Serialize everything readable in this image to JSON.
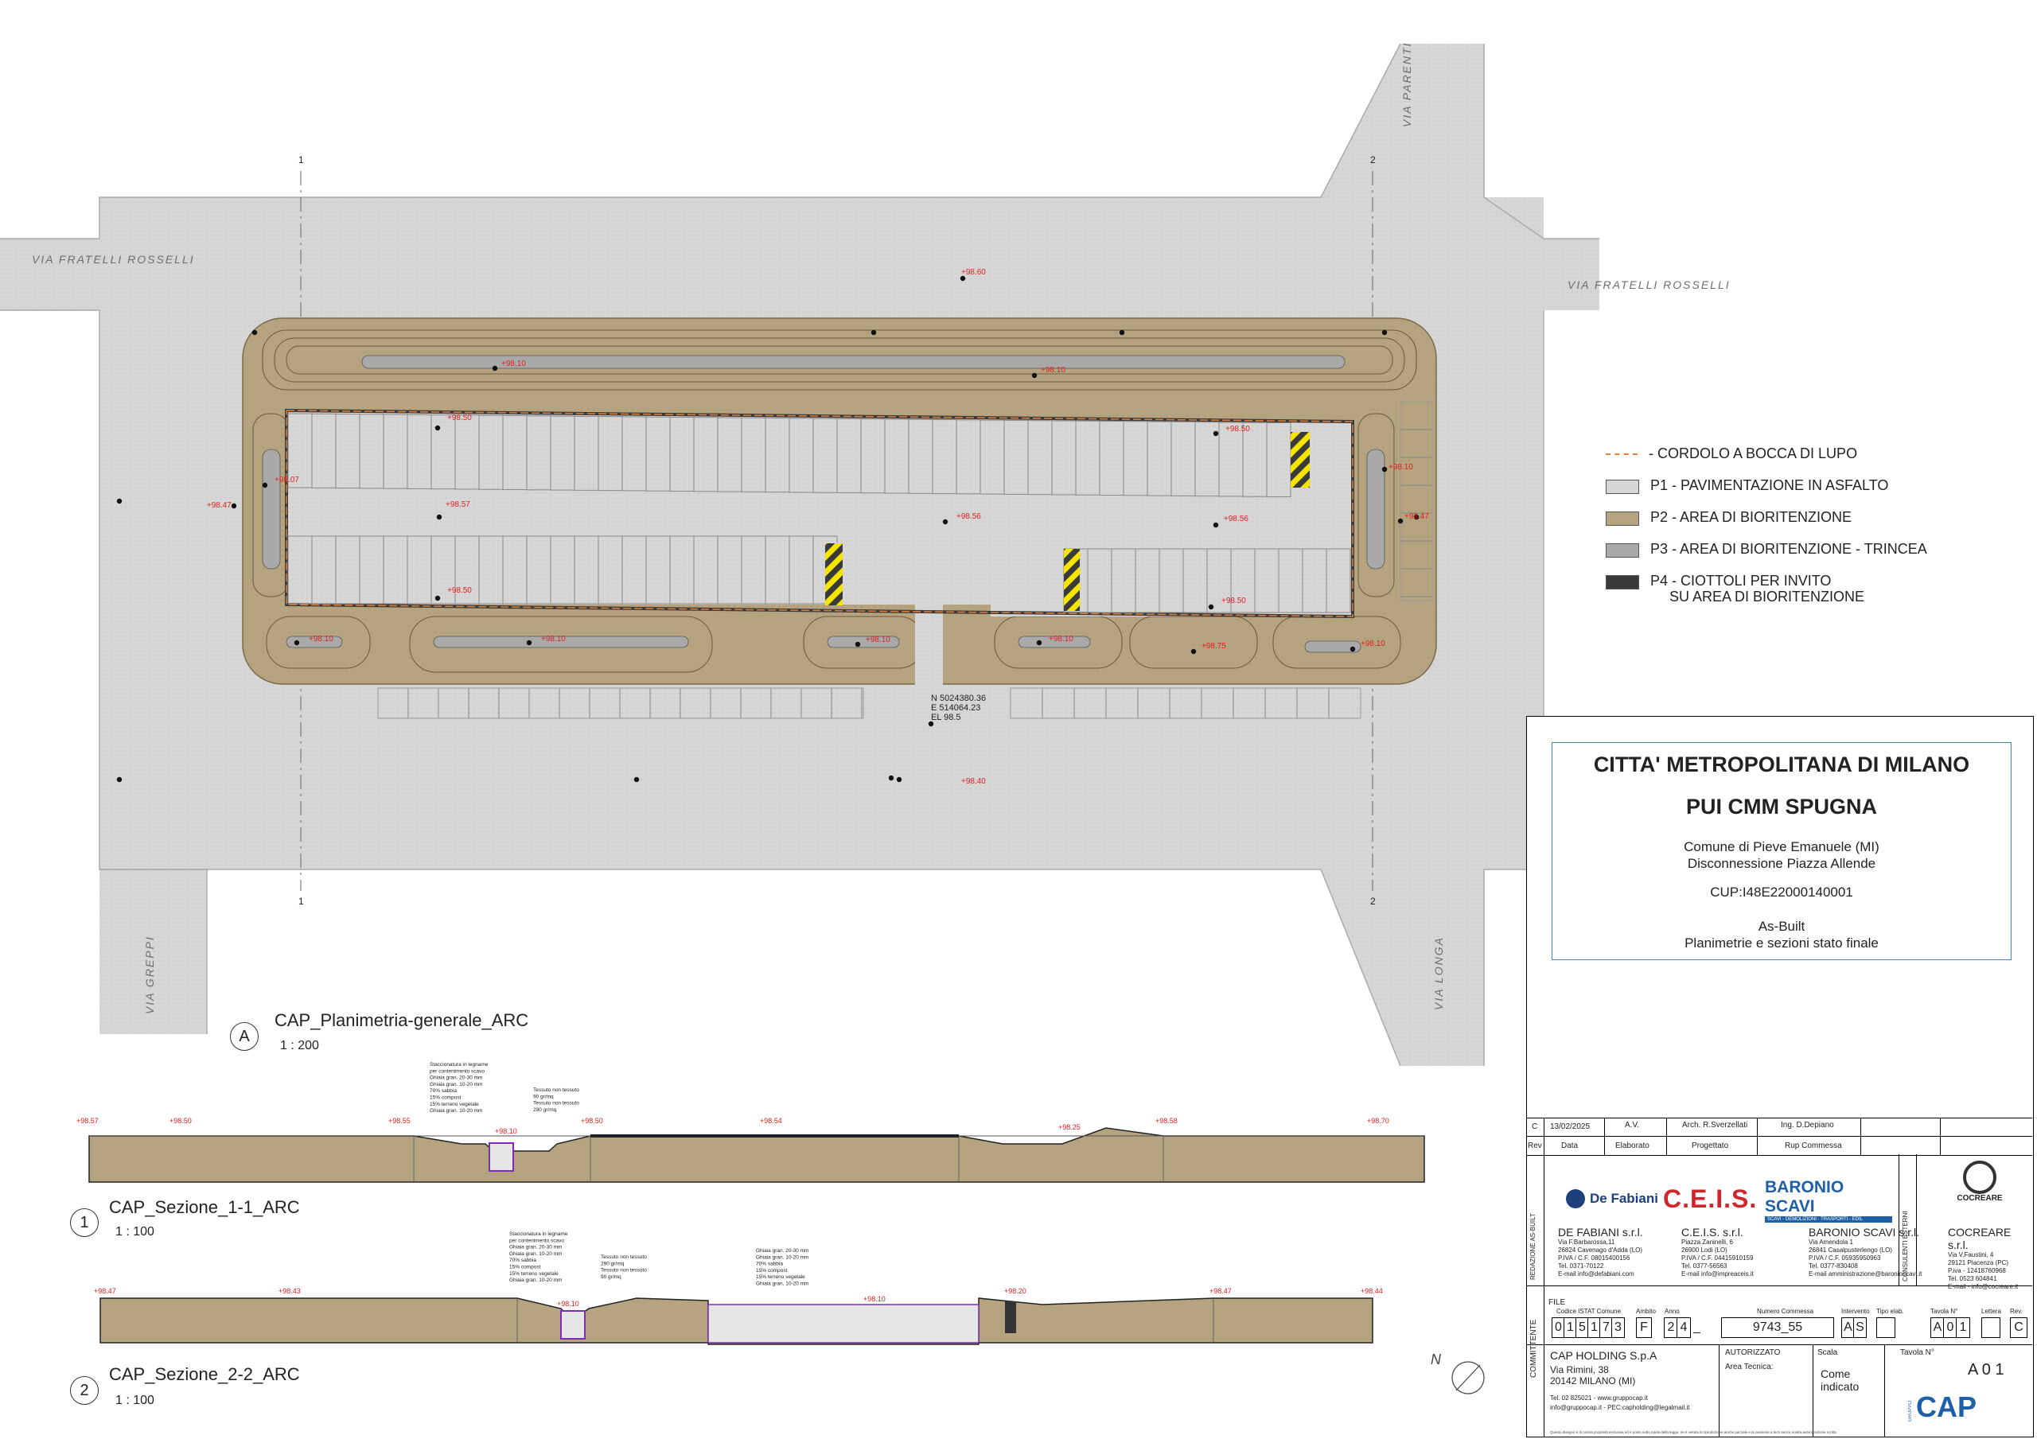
{
  "streets": {
    "via_fratelli_rosselli_left": "VIA FRATELLI ROSSELLI",
    "via_fratelli_rosselli_right": "VIA FRATELLI ROSSELLI",
    "via_parenti": "VIA PARENTI",
    "via_greppi": "VIA GREPPI",
    "via_longa": "VIA LONGA"
  },
  "grid": {
    "axis_1": "1",
    "axis_2": "2"
  },
  "elevations": {
    "top": "+98.60",
    "bottom": "+98.40",
    "left": "+98.47",
    "right": "+98.47",
    "park_ul": "+98.50",
    "park_ur": "+98.50",
    "park_ll": "+98.50",
    "park_lr": "+98.50",
    "center_l": "+98.57",
    "center_m": "+98.56",
    "center_r": "+98.56",
    "bio_1": "+98.10",
    "bio_2": "+98.10",
    "bio_3": "+98.10",
    "bio_4": "+98.07",
    "bio_5": "+98.10",
    "bio_6": "+98.10",
    "bio_7": "+98.10",
    "bio_8": "+98.10",
    "bio_9": "+98.10",
    "bio_10": "+98.10",
    "bio_11": "+98.75"
  },
  "coordinates": {
    "n": "N 5024380.36",
    "e": "E 514064.23",
    "el": "EL 98.5"
  },
  "legend": [
    {
      "label": "- CORDOLO A BOCCA DI LUPO",
      "kind": "dash",
      "color": "#e0813a"
    },
    {
      "label": "P1 - PAVIMENTAZIONE IN ASFALTO",
      "kind": "fill",
      "color": "#d6d6d6"
    },
    {
      "label": "P2 - AREA DI BIORITENZIONE",
      "kind": "fill",
      "color": "#b5a47f"
    },
    {
      "label": "P3 - AREA DI BIORITENZIONE - TRINCEA",
      "kind": "fill",
      "color": "#a9a9a9"
    },
    {
      "label": "P4 - CIOTTOLI PER INVITO",
      "label2": "SU AREA DI BIORITENZIONE",
      "kind": "fill",
      "color": "#3a3a3a"
    }
  ],
  "views": {
    "plan": {
      "marker": "A",
      "title": "CAP_Planimetria-generale_ARC",
      "scale": "1 : 200"
    },
    "section1": {
      "marker": "1",
      "title": "CAP_Sezione_1-1_ARC",
      "scale": "1 : 100"
    },
    "section2": {
      "marker": "2",
      "title": "CAP_Sezione_2-2_ARC",
      "scale": "1 : 100"
    }
  },
  "section1_levels": [
    "+98.57",
    "+98.50",
    "+98.55",
    "+98.10",
    "+98.50",
    "+98.54",
    "+98.25",
    "+98.58",
    "+98.70"
  ],
  "section2_levels": [
    "+98.47",
    "+98.43",
    "+98.10",
    "+98.10",
    "+98.20",
    "+98.47",
    "+98.44"
  ],
  "section1_notes": [
    "Staccionatura in legname",
    "per contenimento scavo",
    "Ghiaia gran. 20-30 mm",
    "Ghiaia gran. 10-20 mm",
    "70% sabbia",
    "15% compost",
    "15% terreno vegetale",
    "Ghiaia gran. 10-20 mm",
    "Tessuto non tessuto",
    "90 gr/mq",
    "Tessuto non tessuto",
    "290 gr/mq"
  ],
  "section2_notes_a": [
    "Staccionatura in legname",
    "per contenimento scavo",
    "Ghiaia gran. 20-30 mm",
    "Ghiaia gran. 10-20 mm",
    "70% sabbia",
    "15% compost",
    "15% terreno vegetale",
    "Ghiaia gran. 10-20 mm",
    "Tessuto non tessuto",
    "290 gr/mq",
    "Tessuto non tessuto",
    "90 gr/mq"
  ],
  "section2_notes_b": [
    "Ghiaia gran. 20-30 mm",
    "Ghiaia gran. 10-20 mm",
    "70% sabbia",
    "15% compost",
    "15% terreno vegetale",
    "Ghiaia gran. 10-20 mm"
  ],
  "title_block": {
    "line1": "CITTA' METROPOLITANA DI MILANO",
    "line2": "PUI CMM SPUGNA",
    "comune": "Comune di Pieve Emanuele (MI)",
    "oggetto": "Disconnessione Piazza Allende",
    "cup": "CUP:I48E22000140001",
    "fase": "As-Built",
    "descr": "Planimetrie e sezioni stato finale"
  },
  "revisions": {
    "rev": "C",
    "date": "13/02/2025",
    "elaborato": "A.V.",
    "progettato": "Arch. R.Sverzellati",
    "rup": "Ing. D.Depiano",
    "h_rev": "Rev",
    "h_data": "Data",
    "h_elaborato": "Elaborato",
    "h_progettato": "Progettato",
    "h_rup": "Rup Commessa"
  },
  "side_labels": {
    "redazione": "REDAZIONE AS-BUILT",
    "consulenti": "CONSULENTI ESTERNI",
    "committente": "COMMITTENTE"
  },
  "logos": {
    "defabiani": "De Fabiani",
    "ceis": "C.E.I.S.",
    "baronio": "BARONIO SCAVI",
    "baronio_sub": "SCAVI - DEMOLIZIONI - TRASPORTI - EDIL",
    "cocreare": "COCREARE",
    "cap": "CAP",
    "cap_gruppo": "GRUPPO"
  },
  "companies": [
    {
      "name": "DE FABIANI s.r.l.",
      "l1": "Via F.Barbarossa,11",
      "l2": "26824 Cavenago d'Adda (LO)",
      "l3": "P.IVA / C.F. 08015400156",
      "l4": "Tel. 0371-70122",
      "l5": "E-mail  info@defabiani.com"
    },
    {
      "name": "C.E.I.S. s.r.l.",
      "l1": "Piazza Zaninelli, 6",
      "l2": "26900 Lodi (LO)",
      "l3": "P.IVA / C.F. 04415910159",
      "l4": "Tel. 0377-56563",
      "l5": "E-mail  info@impreaceis.it"
    },
    {
      "name": "BARONIO SCAVI s.r.l.",
      "l1": "Via Amendola 1",
      "l2": "26841 Casalpusterlengo (LO)",
      "l3": "P.IVA / C.F. 05935950963",
      "l4": "Tel. 0377-830408",
      "l5": "E-mail  amministrazione@baronioscavi.it"
    },
    {
      "name": "COCREARE s.r.l.",
      "l1": "Via V.Faustini, 4",
      "l2": "29121 Piacenza (PC)",
      "l3": "P.iva - 12418760968",
      "l4": "Tel. 0523 604841",
      "l5": "E-mail - info@cocreare.it"
    }
  ],
  "file": {
    "label": "FILE",
    "h_istat": "Codice ISTAT Comune",
    "h_ambito": "Ambito",
    "h_anno": "Anno",
    "h_commessa": "Numero Commessa",
    "h_intervento": "Intervento",
    "h_tipo": "Tipo elab.",
    "h_tavola": "Tavola N°",
    "h_lettera": "Lettera",
    "h_rev": "Rev.",
    "istat": [
      "0",
      "1",
      "5",
      "1",
      "7",
      "3"
    ],
    "ambito": "F",
    "anno": [
      "2",
      "4"
    ],
    "sep": "_",
    "commessa": "9743_55",
    "intervento": [
      "A",
      "S"
    ],
    "tavola": [
      "A",
      "0",
      "1"
    ],
    "rev": "C"
  },
  "committente": {
    "name": "CAP HOLDING S.p.A",
    "l1": "Via Rimini, 38",
    "l2": "20142 MILANO (MI)",
    "l3": "Tel. 02 825021 - www.gruppocap.it",
    "l4": "info@gruppocap.it  -  PEC:capholding@legalmail.it",
    "autorizzato": "AUTORIZZATO",
    "area": "Area Tecnica:",
    "scala_h": "Scala",
    "scala": "Come",
    "scala2": "indicato",
    "tavola_h": "Tavola N°",
    "tavola": "A 0 1"
  },
  "disclaimer": "Questo disegno è di nostra proprietà esclusiva ed è posto sotto tutela della legge, ne è vietata la riproduzione anche parziale e la cessione a terzi senza nostra autorizzazione scritta",
  "north": "N",
  "colors": {
    "asphalt": "#d6d6d6",
    "bio": "#b5a47f",
    "trench": "#a9a9a9",
    "curb": "#3a3a3a",
    "accent": "#3a86c8",
    "elev": "#e02020"
  }
}
